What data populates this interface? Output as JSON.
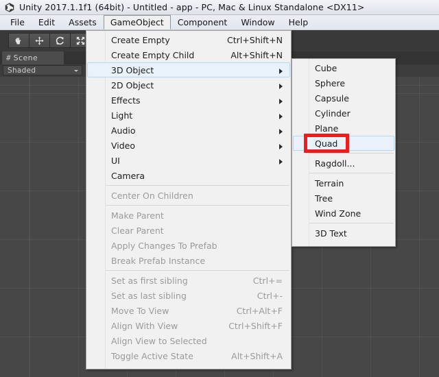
{
  "window": {
    "title": "Unity 2017.1.1f1 (64bit) - Untitled - app - PC, Mac & Linux Standalone <DX11>",
    "logo_icon": "unity-cube-icon"
  },
  "menubar": {
    "items": [
      {
        "label": "File",
        "open": false
      },
      {
        "label": "Edit",
        "open": false
      },
      {
        "label": "Assets",
        "open": false
      },
      {
        "label": "GameObject",
        "open": true
      },
      {
        "label": "Component",
        "open": false
      },
      {
        "label": "Window",
        "open": false
      },
      {
        "label": "Help",
        "open": false
      }
    ]
  },
  "toolbar": {
    "tools": [
      {
        "icon": "hand-tool-icon",
        "name": "hand-tool"
      },
      {
        "icon": "move-tool-icon",
        "name": "move-tool"
      },
      {
        "icon": "rotate-tool-icon",
        "name": "rotate-tool"
      },
      {
        "icon": "scale-tool-icon",
        "name": "scale-tool"
      }
    ]
  },
  "scene_panel": {
    "tab_label": "Scene",
    "tab_icon": "grid-hash-icon",
    "shading_mode": "Shaded",
    "shading_dropdown_icon": "chevron-down-icon"
  },
  "gameobject_menu": {
    "items": [
      {
        "label": "Create Empty",
        "shortcut": "Ctrl+Shift+N",
        "disabled": false,
        "submenu": false,
        "highlight": false
      },
      {
        "label": "Create Empty Child",
        "shortcut": "Alt+Shift+N",
        "disabled": false,
        "submenu": false,
        "highlight": false
      },
      {
        "label": "3D Object",
        "shortcut": "",
        "disabled": false,
        "submenu": true,
        "highlight": true
      },
      {
        "label": "2D Object",
        "shortcut": "",
        "disabled": false,
        "submenu": true,
        "highlight": false
      },
      {
        "label": "Effects",
        "shortcut": "",
        "disabled": false,
        "submenu": true,
        "highlight": false
      },
      {
        "label": "Light",
        "shortcut": "",
        "disabled": false,
        "submenu": true,
        "highlight": false
      },
      {
        "label": "Audio",
        "shortcut": "",
        "disabled": false,
        "submenu": true,
        "highlight": false
      },
      {
        "label": "Video",
        "shortcut": "",
        "disabled": false,
        "submenu": true,
        "highlight": false
      },
      {
        "label": "UI",
        "shortcut": "",
        "disabled": false,
        "submenu": true,
        "highlight": false
      },
      {
        "label": "Camera",
        "shortcut": "",
        "disabled": false,
        "submenu": false,
        "highlight": false
      },
      {
        "separator": true
      },
      {
        "label": "Center On Children",
        "shortcut": "",
        "disabled": true,
        "submenu": false,
        "highlight": false
      },
      {
        "separator": true
      },
      {
        "label": "Make Parent",
        "shortcut": "",
        "disabled": true,
        "submenu": false,
        "highlight": false
      },
      {
        "label": "Clear Parent",
        "shortcut": "",
        "disabled": true,
        "submenu": false,
        "highlight": false
      },
      {
        "label": "Apply Changes To Prefab",
        "shortcut": "",
        "disabled": true,
        "submenu": false,
        "highlight": false
      },
      {
        "label": "Break Prefab Instance",
        "shortcut": "",
        "disabled": true,
        "submenu": false,
        "highlight": false
      },
      {
        "separator": true
      },
      {
        "label": "Set as first sibling",
        "shortcut": "Ctrl+=",
        "disabled": true,
        "submenu": false,
        "highlight": false
      },
      {
        "label": "Set as last sibling",
        "shortcut": "Ctrl+-",
        "disabled": true,
        "submenu": false,
        "highlight": false
      },
      {
        "label": "Move To View",
        "shortcut": "Ctrl+Alt+F",
        "disabled": true,
        "submenu": false,
        "highlight": false
      },
      {
        "label": "Align With View",
        "shortcut": "Ctrl+Shift+F",
        "disabled": true,
        "submenu": false,
        "highlight": false
      },
      {
        "label": "Align View to Selected",
        "shortcut": "",
        "disabled": true,
        "submenu": false,
        "highlight": false
      },
      {
        "label": "Toggle Active State",
        "shortcut": "Alt+Shift+A",
        "disabled": true,
        "submenu": false,
        "highlight": false
      }
    ]
  },
  "threed_submenu": {
    "items": [
      {
        "label": "Cube",
        "disabled": false,
        "highlight": false
      },
      {
        "label": "Sphere",
        "disabled": false,
        "highlight": false
      },
      {
        "label": "Capsule",
        "disabled": false,
        "highlight": false
      },
      {
        "label": "Cylinder",
        "disabled": false,
        "highlight": false
      },
      {
        "label": "Plane",
        "disabled": false,
        "highlight": false
      },
      {
        "label": "Quad",
        "disabled": false,
        "highlight": true
      },
      {
        "separator": true
      },
      {
        "label": "Ragdoll...",
        "disabled": false,
        "highlight": false
      },
      {
        "separator": true
      },
      {
        "label": "Terrain",
        "disabled": false,
        "highlight": false
      },
      {
        "label": "Tree",
        "disabled": false,
        "highlight": false
      },
      {
        "label": "Wind Zone",
        "disabled": false,
        "highlight": false
      },
      {
        "separator": true
      },
      {
        "label": "3D Text",
        "disabled": false,
        "highlight": false
      }
    ]
  },
  "annotation": {
    "target_label": "Quad",
    "color": "#ee1c1c"
  },
  "colors": {
    "menu_background": "#f1f1f1",
    "menu_highlight": "#e9f2fb",
    "scene_background": "#474747",
    "chrome_dark": "#393939",
    "titlebar": "#e8ebf0"
  }
}
